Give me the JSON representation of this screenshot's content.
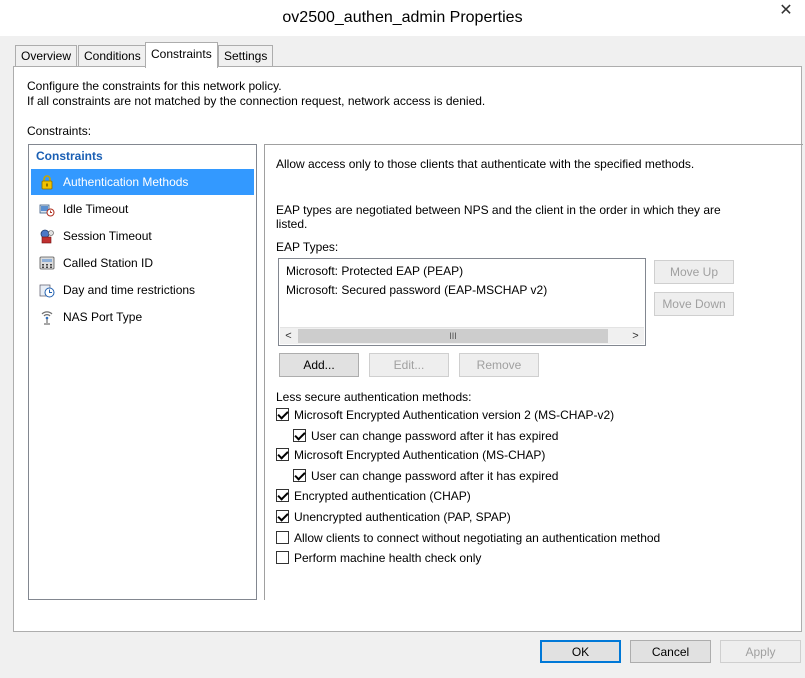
{
  "window": {
    "title": "ov2500_authen_admin Properties",
    "close_glyph": "✕"
  },
  "tabs": [
    {
      "label": "Overview",
      "active": false
    },
    {
      "label": "Conditions",
      "active": false
    },
    {
      "label": "Constraints",
      "active": true
    },
    {
      "label": "Settings",
      "active": false
    }
  ],
  "description": {
    "line1": "Configure the constraints for this network policy.",
    "line2": "If all constraints are not matched by the connection request, network access is denied."
  },
  "constraints_label": "Constraints:",
  "constraints_list": {
    "header": "Constraints",
    "items": [
      {
        "label": "Authentication Methods",
        "icon": "lock-icon",
        "selected": true
      },
      {
        "label": "Idle Timeout",
        "icon": "idle-timeout-icon",
        "selected": false
      },
      {
        "label": "Session Timeout",
        "icon": "session-timeout-icon",
        "selected": false
      },
      {
        "label": "Called Station ID",
        "icon": "phone-icon",
        "selected": false
      },
      {
        "label": "Day and time restrictions",
        "icon": "clock-icon",
        "selected": false
      },
      {
        "label": "NAS Port Type",
        "icon": "network-port-icon",
        "selected": false
      }
    ]
  },
  "auth": {
    "intro": "Allow access only to those clients that authenticate with the specified methods.",
    "eap_note_line1": "EAP types are negotiated between NPS and the client in the order in which they are",
    "eap_note_line2": "listed.",
    "eap_types_label": "EAP Types:",
    "eap_types": [
      "Microsoft: Protected EAP (PEAP)",
      "Microsoft: Secured password (EAP-MSCHAP v2)"
    ],
    "scroll_left": "<",
    "scroll_right": ">",
    "scroll_thumb": "III",
    "move_up": "Move Up",
    "move_down": "Move Down",
    "add": "Add...",
    "edit": "Edit...",
    "remove": "Remove",
    "less_secure_label": "Less secure authentication methods:",
    "methods": [
      {
        "label": "Microsoft Encrypted Authentication version 2 (MS-CHAP-v2)",
        "checked": true,
        "indent": false
      },
      {
        "label": "User can change password after it has expired",
        "checked": true,
        "indent": true
      },
      {
        "label": "Microsoft Encrypted Authentication (MS-CHAP)",
        "checked": true,
        "indent": false
      },
      {
        "label": "User can change password after it has expired",
        "checked": true,
        "indent": true
      },
      {
        "label": "Encrypted authentication (CHAP)",
        "checked": true,
        "indent": false
      },
      {
        "label": "Unencrypted authentication (PAP, SPAP)",
        "checked": true,
        "indent": false
      },
      {
        "label": "Allow clients to connect without negotiating an authentication method",
        "checked": false,
        "indent": false
      },
      {
        "label": "Perform machine health check only",
        "checked": false,
        "indent": false
      }
    ]
  },
  "footer": {
    "ok": "OK",
    "cancel": "Cancel",
    "apply": "Apply"
  }
}
